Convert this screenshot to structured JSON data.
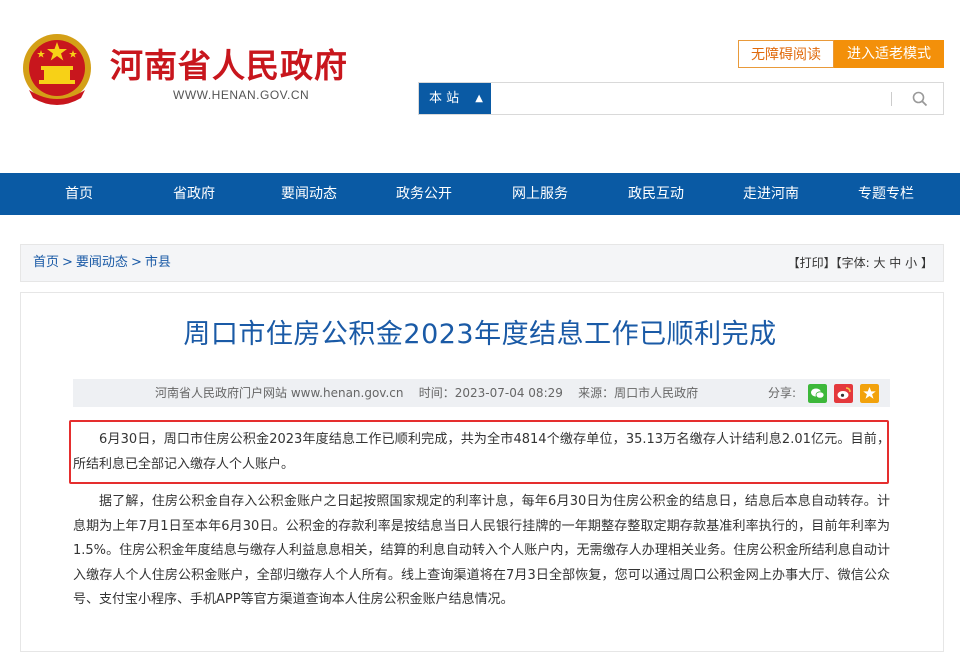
{
  "header": {
    "site_title": "河南省人民政府",
    "site_url": "WWW.HENAN.GOV.CN",
    "accessible_label": "无障碍阅读",
    "elder_label": "进入适老模式",
    "brand_color": "#c8161d"
  },
  "search": {
    "scope_label": "本 站",
    "placeholder": ""
  },
  "nav": {
    "items": [
      "首页",
      "省政府",
      "要闻动态",
      "政务公开",
      "网上服务",
      "政民互动",
      "走进河南",
      "专题专栏"
    ],
    "color": "#0a5aa4"
  },
  "breadcrumb": {
    "home": "首页",
    "section": "要闻动态",
    "sub": "市县",
    "sep": ">"
  },
  "tools": {
    "print": "【打印】",
    "font_prefix": "【字体:",
    "large": "大",
    "medium": "中",
    "small": "小",
    "font_suffix": "】"
  },
  "article": {
    "title": "周口市住房公积金2023年度结息工作已顺利完成",
    "meta": "河南省人民政府门户网站 www.henan.gov.cn    时间：2023-07-04 08:29    来源：周口市人民政府",
    "share_label": "分享:",
    "paragraphs": [
      "6月30日，周口市住房公积金2023年度结息工作已顺利完成，共为全市4814个缴存单位，35.13万名缴存人计结利息2.01亿元。目前，所结利息已全部记入缴存人个人账户。",
      "据了解，住房公积金自存入公积金账户之日起按照国家规定的利率计息，每年6月30日为住房公积金的结息日，结息后本息自动转存。计息期为上年7月1日至本年6月30日。公积金的存款利率是按结息当日人民银行挂牌的一年期整存整取定期存款基准利率执行的，目前年利率为1.5%。住房公积金年度结息与缴存人利益息息相关，结算的利息自动转入个人账户内，无需缴存人办理相关业务。住房公积金所结利息自动计入缴存人个人住房公积金账户，全部归缴存人个人所有。线上查询渠道将在7月3日全部恢复，您可以通过周口公积金网上办事大厅、微信公众号、支付宝小程序、手机APP等官方渠道查询本人住房公积金账户结息情况。"
    ]
  }
}
